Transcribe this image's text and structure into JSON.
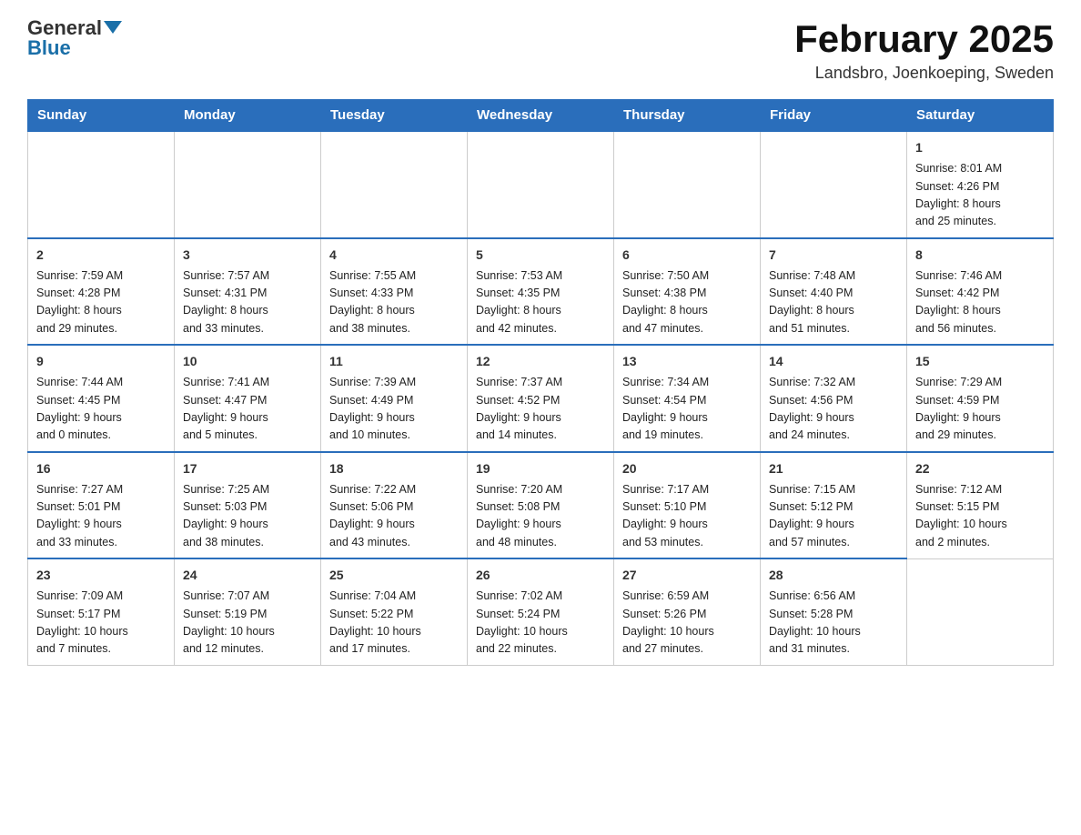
{
  "header": {
    "logo_general": "General",
    "logo_blue": "Blue",
    "month_title": "February 2025",
    "location": "Landsbro, Joenkoeping, Sweden"
  },
  "days_of_week": [
    "Sunday",
    "Monday",
    "Tuesday",
    "Wednesday",
    "Thursday",
    "Friday",
    "Saturday"
  ],
  "weeks": [
    [
      {
        "day": "",
        "info": ""
      },
      {
        "day": "",
        "info": ""
      },
      {
        "day": "",
        "info": ""
      },
      {
        "day": "",
        "info": ""
      },
      {
        "day": "",
        "info": ""
      },
      {
        "day": "",
        "info": ""
      },
      {
        "day": "1",
        "info": "Sunrise: 8:01 AM\nSunset: 4:26 PM\nDaylight: 8 hours\nand 25 minutes."
      }
    ],
    [
      {
        "day": "2",
        "info": "Sunrise: 7:59 AM\nSunset: 4:28 PM\nDaylight: 8 hours\nand 29 minutes."
      },
      {
        "day": "3",
        "info": "Sunrise: 7:57 AM\nSunset: 4:31 PM\nDaylight: 8 hours\nand 33 minutes."
      },
      {
        "day": "4",
        "info": "Sunrise: 7:55 AM\nSunset: 4:33 PM\nDaylight: 8 hours\nand 38 minutes."
      },
      {
        "day": "5",
        "info": "Sunrise: 7:53 AM\nSunset: 4:35 PM\nDaylight: 8 hours\nand 42 minutes."
      },
      {
        "day": "6",
        "info": "Sunrise: 7:50 AM\nSunset: 4:38 PM\nDaylight: 8 hours\nand 47 minutes."
      },
      {
        "day": "7",
        "info": "Sunrise: 7:48 AM\nSunset: 4:40 PM\nDaylight: 8 hours\nand 51 minutes."
      },
      {
        "day": "8",
        "info": "Sunrise: 7:46 AM\nSunset: 4:42 PM\nDaylight: 8 hours\nand 56 minutes."
      }
    ],
    [
      {
        "day": "9",
        "info": "Sunrise: 7:44 AM\nSunset: 4:45 PM\nDaylight: 9 hours\nand 0 minutes."
      },
      {
        "day": "10",
        "info": "Sunrise: 7:41 AM\nSunset: 4:47 PM\nDaylight: 9 hours\nand 5 minutes."
      },
      {
        "day": "11",
        "info": "Sunrise: 7:39 AM\nSunset: 4:49 PM\nDaylight: 9 hours\nand 10 minutes."
      },
      {
        "day": "12",
        "info": "Sunrise: 7:37 AM\nSunset: 4:52 PM\nDaylight: 9 hours\nand 14 minutes."
      },
      {
        "day": "13",
        "info": "Sunrise: 7:34 AM\nSunset: 4:54 PM\nDaylight: 9 hours\nand 19 minutes."
      },
      {
        "day": "14",
        "info": "Sunrise: 7:32 AM\nSunset: 4:56 PM\nDaylight: 9 hours\nand 24 minutes."
      },
      {
        "day": "15",
        "info": "Sunrise: 7:29 AM\nSunset: 4:59 PM\nDaylight: 9 hours\nand 29 minutes."
      }
    ],
    [
      {
        "day": "16",
        "info": "Sunrise: 7:27 AM\nSunset: 5:01 PM\nDaylight: 9 hours\nand 33 minutes."
      },
      {
        "day": "17",
        "info": "Sunrise: 7:25 AM\nSunset: 5:03 PM\nDaylight: 9 hours\nand 38 minutes."
      },
      {
        "day": "18",
        "info": "Sunrise: 7:22 AM\nSunset: 5:06 PM\nDaylight: 9 hours\nand 43 minutes."
      },
      {
        "day": "19",
        "info": "Sunrise: 7:20 AM\nSunset: 5:08 PM\nDaylight: 9 hours\nand 48 minutes."
      },
      {
        "day": "20",
        "info": "Sunrise: 7:17 AM\nSunset: 5:10 PM\nDaylight: 9 hours\nand 53 minutes."
      },
      {
        "day": "21",
        "info": "Sunrise: 7:15 AM\nSunset: 5:12 PM\nDaylight: 9 hours\nand 57 minutes."
      },
      {
        "day": "22",
        "info": "Sunrise: 7:12 AM\nSunset: 5:15 PM\nDaylight: 10 hours\nand 2 minutes."
      }
    ],
    [
      {
        "day": "23",
        "info": "Sunrise: 7:09 AM\nSunset: 5:17 PM\nDaylight: 10 hours\nand 7 minutes."
      },
      {
        "day": "24",
        "info": "Sunrise: 7:07 AM\nSunset: 5:19 PM\nDaylight: 10 hours\nand 12 minutes."
      },
      {
        "day": "25",
        "info": "Sunrise: 7:04 AM\nSunset: 5:22 PM\nDaylight: 10 hours\nand 17 minutes."
      },
      {
        "day": "26",
        "info": "Sunrise: 7:02 AM\nSunset: 5:24 PM\nDaylight: 10 hours\nand 22 minutes."
      },
      {
        "day": "27",
        "info": "Sunrise: 6:59 AM\nSunset: 5:26 PM\nDaylight: 10 hours\nand 27 minutes."
      },
      {
        "day": "28",
        "info": "Sunrise: 6:56 AM\nSunset: 5:28 PM\nDaylight: 10 hours\nand 31 minutes."
      },
      {
        "day": "",
        "info": ""
      }
    ]
  ]
}
